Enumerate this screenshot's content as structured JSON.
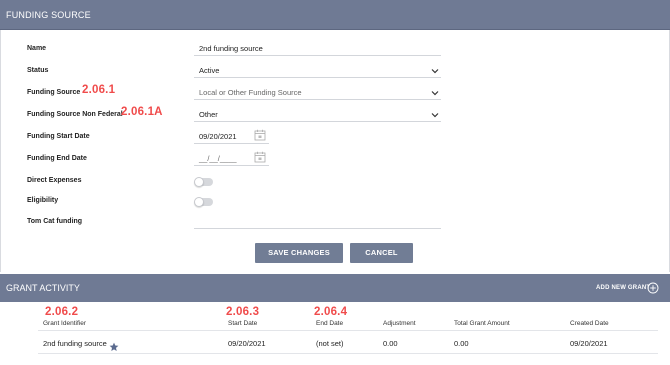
{
  "header": {
    "title": "FUNDING SOURCE"
  },
  "form": {
    "name": {
      "label": "Name",
      "value": "2nd funding source"
    },
    "status": {
      "label": "Status",
      "value": "Active"
    },
    "funding_source": {
      "label": "Funding Source",
      "value": "Local or Other Funding Source",
      "annotation": "2.06.1"
    },
    "funding_source_non_federal": {
      "label": "Funding Source Non Federal",
      "value": "Other",
      "annotation": "2.06.1A"
    },
    "start_date": {
      "label": "Funding Start Date",
      "value": "09/20/2021"
    },
    "end_date": {
      "label": "Funding End Date",
      "placeholder": "__/__/____"
    },
    "direct_expenses": {
      "label": "Direct Expenses",
      "enabled": false
    },
    "eligibility": {
      "label": "Eligibility",
      "enabled": false
    },
    "tom_cat": {
      "label": "Tom Cat funding",
      "value": ""
    },
    "save_label": "SAVE CHANGES",
    "cancel_label": "CANCEL"
  },
  "grant_activity": {
    "title": "GRANT ACTIVITY",
    "add_label": "ADD NEW GRANT",
    "annotations": {
      "identifier": "2.06.2",
      "start": "2.06.3",
      "end": "2.06.4"
    },
    "columns": {
      "identifier": "Grant Identifier",
      "start": "Start Date",
      "end": "End Date",
      "adjustment": "Adjustment",
      "total": "Total Grant Amount",
      "created": "Created Date"
    },
    "rows": [
      {
        "identifier": "2nd funding source",
        "start": "09/20/2021",
        "end": "(not set)",
        "adjustment": "0.00",
        "total": "0.00",
        "created": "09/20/2021"
      }
    ]
  },
  "colors": {
    "header": "#6f7a94",
    "button": "#717d95",
    "annotation": "#f04b4b",
    "star": "#5b6b8f"
  },
  "icons": {
    "dropdown": "chevron-down-icon",
    "calendar": "calendar-icon",
    "add": "plus-circle-icon",
    "favorite": "star-icon"
  }
}
